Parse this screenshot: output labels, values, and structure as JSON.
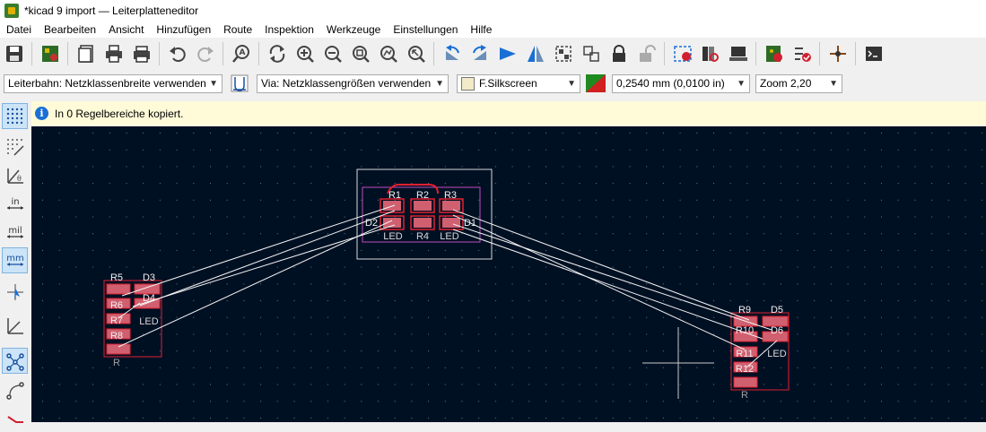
{
  "window": {
    "title": "*kicad 9 import — Leiterplatteneditor"
  },
  "menu": {
    "items": [
      "Datei",
      "Bearbeiten",
      "Ansicht",
      "Hinzufügen",
      "Route",
      "Inspektion",
      "Werkzeuge",
      "Einstellungen",
      "Hilfe"
    ]
  },
  "toolbar": {
    "buttons": [
      "save",
      "board-setup",
      "page-settings",
      "print",
      "plot",
      "undo",
      "redo",
      "find",
      "redraw",
      "zoom-in",
      "zoom-out",
      "zoom-fit",
      "zoom-objects",
      "zoom-selection",
      "rotate-ccw",
      "rotate-cw",
      "flip",
      "mirror",
      "group",
      "ungroup",
      "lock",
      "unlock",
      "netlist",
      "footprint-editor",
      "footprint-browser",
      "3d-viewer",
      "drc",
      "design-rules",
      "schematic",
      "scripting-console"
    ]
  },
  "options": {
    "track_width": "Leiterbahn: Netzklassenbreite verwenden",
    "via_size": "Via: Netzklassengrößen verwenden",
    "layer": "F.Silkscreen",
    "layer_color": "#f2eac8",
    "grid": "0,2540 mm (0,0100 in)",
    "zoom": "Zoom 2,20"
  },
  "infobar": {
    "message": "In 0 Regelbereiche kopiert."
  },
  "canvas": {
    "background": "#001023",
    "labels": {
      "group_top": [
        "R1",
        "R2",
        "R3",
        "D2",
        "D1",
        "LED",
        "R4",
        "LED"
      ],
      "group_left": [
        "R5",
        "D3",
        "R6",
        "R7",
        "R8",
        "D4",
        "LED",
        "R"
      ],
      "group_right": [
        "R9",
        "D5",
        "R10",
        "R11",
        "R12",
        "D6",
        "LED",
        "R"
      ]
    }
  }
}
